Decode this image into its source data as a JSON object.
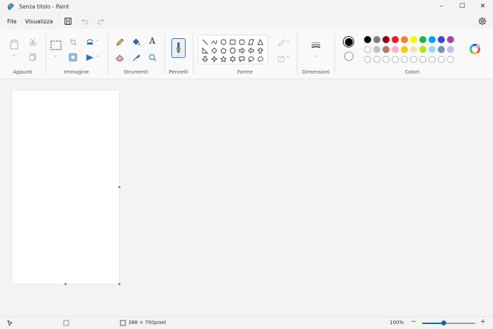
{
  "window": {
    "title": "Senza titolo - Paint",
    "controls": {
      "minimize": "–",
      "maximize": "☐",
      "close": "✕"
    }
  },
  "menu": {
    "file": "File",
    "view": "Visualizza"
  },
  "ribbon": {
    "groups": {
      "clipboard": "Appunti",
      "image": "Immagine",
      "tools": "Strumenti",
      "brushes": "Pennelli",
      "shapes": "Forme",
      "size": "Dimensioni",
      "colors": "Colori"
    },
    "text_tool_glyph": "A"
  },
  "colors": {
    "primary": "#000000",
    "secondary": "#ffffff",
    "row1": [
      "#000000",
      "#7f7f7f",
      "#880015",
      "#ed1c24",
      "#ff7f27",
      "#fff200",
      "#22b14c",
      "#00a2e8",
      "#3f48cc",
      "#a349a4"
    ],
    "row2": [
      "#ffffff",
      "#c3c3c3",
      "#b97a57",
      "#ffaec9",
      "#ffc90e",
      "#efe4b0",
      "#b5e61d",
      "#99d9ea",
      "#7092be",
      "#c8bfe7"
    ],
    "accent": "#1f5fa8"
  },
  "status": {
    "canvas_size": "388 × 700pixel",
    "zoom": "100%",
    "zoom_minus": "−",
    "zoom_plus": "+",
    "zoom_fraction": 0.4
  }
}
